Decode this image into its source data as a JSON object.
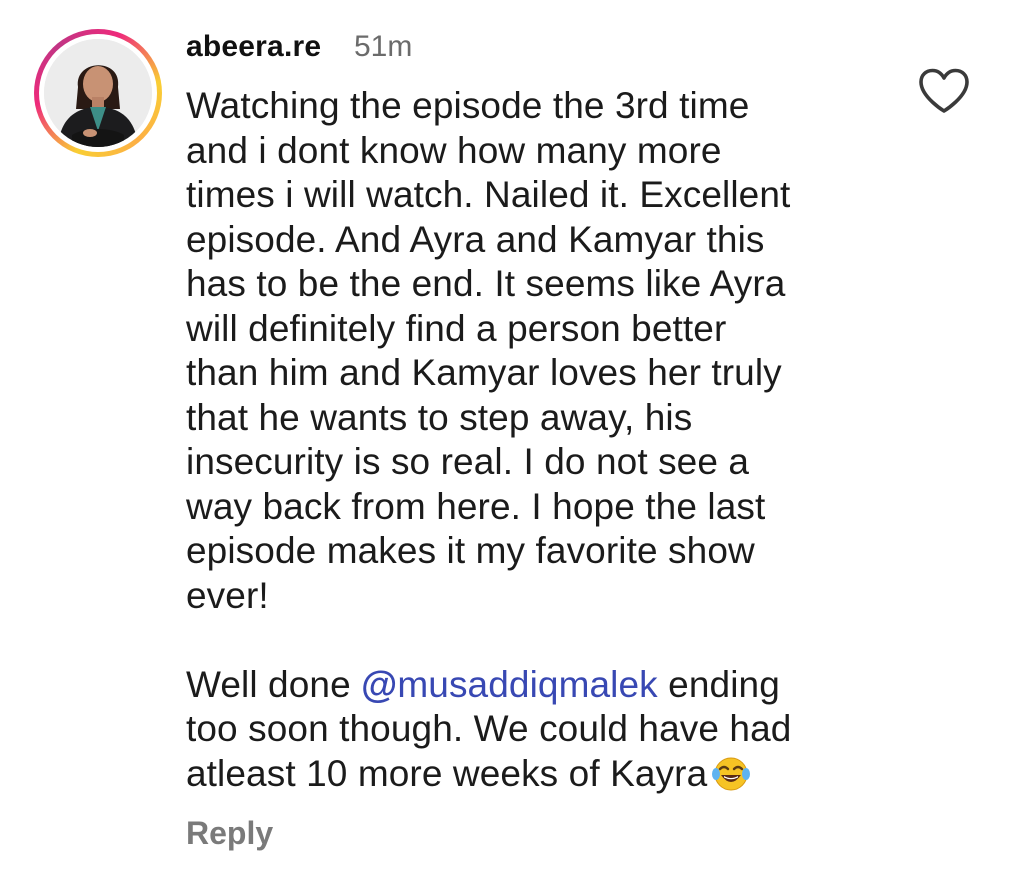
{
  "comment": {
    "username": "abeera.re",
    "timestamp": "51m",
    "paragraph1": [
      "Watching the episode the 3rd time",
      "and i dont know how many more",
      "times i will watch. Nailed it. Excellent",
      "episode. And Ayra and Kamyar this",
      "has to be the end. It seems like Ayra",
      "will definitely find a person better",
      "than him and Kamyar loves her truly",
      "that he wants to step away, his",
      "insecurity is so real. I do not see a",
      "way back from here. I hope the last",
      "episode makes it my favorite show",
      "ever!"
    ],
    "paragraph2": {
      "line1_prefix": "Well done ",
      "mention": "musaddiqmalek",
      "line1_suffix": " ending",
      "line2": "too soon though. We could have had",
      "line3": "atleast 10 more weeks of Kayra",
      "emoji": "face-with-tears-of-joy"
    },
    "reply_label": "Reply"
  },
  "icons": {
    "like": "heart-outline-icon",
    "mention": "threads-at-icon",
    "avatar": "profile-photo"
  },
  "colors": {
    "text": "#1b1b1b",
    "muted": "#6b6b6b",
    "mention": "#3848b3",
    "reply": "#7a7a7a"
  }
}
